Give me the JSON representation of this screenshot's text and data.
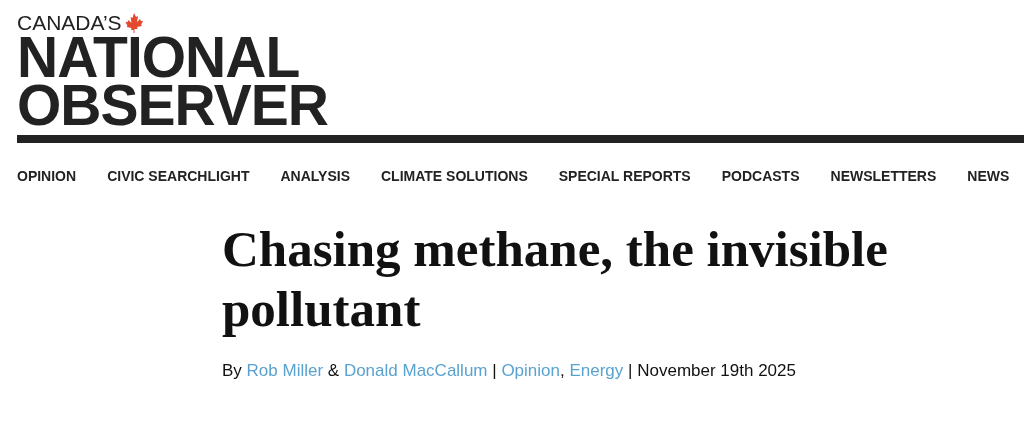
{
  "logo": {
    "tagline": "CANADA’S",
    "line_1": "NATIONAL",
    "line_2": "OBSERVER"
  },
  "nav": [
    "OPINION",
    "CIVIC SEARCHLIGHT",
    "ANALYSIS",
    "CLIMATE SOLUTIONS",
    "SPECIAL REPORTS",
    "PODCASTS",
    "NEWSLETTERS",
    "NEWS"
  ],
  "article": {
    "headline": "Chasing methane, the invisible pollutant",
    "byline": [
      {
        "kind": "text",
        "text": "By "
      },
      {
        "kind": "link",
        "text": "Rob Miller"
      },
      {
        "kind": "text",
        "text": " & "
      },
      {
        "kind": "link",
        "text": "Donald MacCallum"
      },
      {
        "kind": "text",
        "text": " | "
      },
      {
        "kind": "link",
        "text": "Opinion"
      },
      {
        "kind": "text",
        "text": ", "
      },
      {
        "kind": "link",
        "text": "Energy"
      },
      {
        "kind": "text",
        "text": " | November 19th 2025"
      }
    ]
  }
}
